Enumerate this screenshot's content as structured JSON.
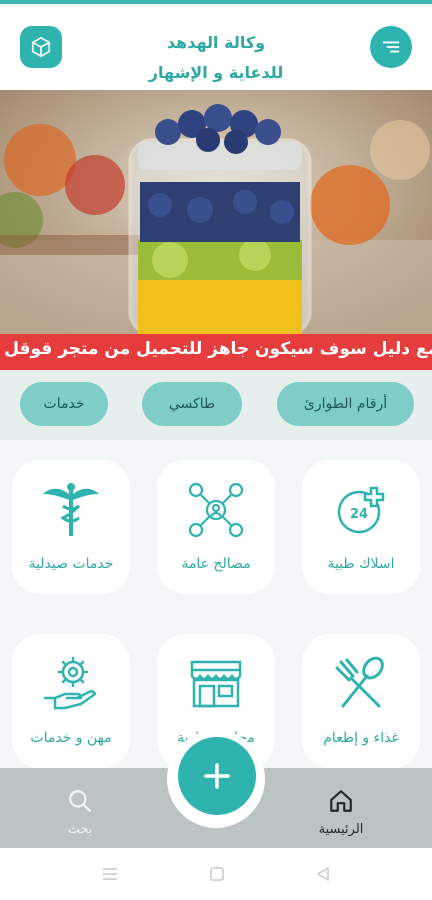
{
  "header": {
    "title_line1": "وكالة الهدهد",
    "title_line2": "للدعاية و الإشهار",
    "left_icon": "box-icon",
    "right_icon": "menu-icon"
  },
  "ticker": {
    "text": "مع دليل سوف سيكون جاهز للتحميل من متجر قوقل ف"
  },
  "chips": [
    "أرقام الطوارئ",
    "طاكسي",
    "خدمات"
  ],
  "services": [
    {
      "label": "اسلاك طبية",
      "icon": "medical-24-icon"
    },
    {
      "label": "مصالح عامة",
      "icon": "network-people-icon"
    },
    {
      "label": "خدمات صيدلية",
      "icon": "caduceus-icon"
    },
    {
      "label": "غذاء و إطعام",
      "icon": "fork-spoon-icon"
    },
    {
      "label": "محلات تجارية",
      "icon": "storefront-icon"
    },
    {
      "label": "مهن و خدمات",
      "icon": "hand-gear-icon"
    }
  ],
  "bottom_nav": {
    "home_label": "الرئيسية",
    "search_label": "بحث"
  },
  "colors": {
    "accent": "#2fb3ae",
    "ticker_bg": "#e53d3d",
    "chip_bg": "#7ecdc8"
  }
}
